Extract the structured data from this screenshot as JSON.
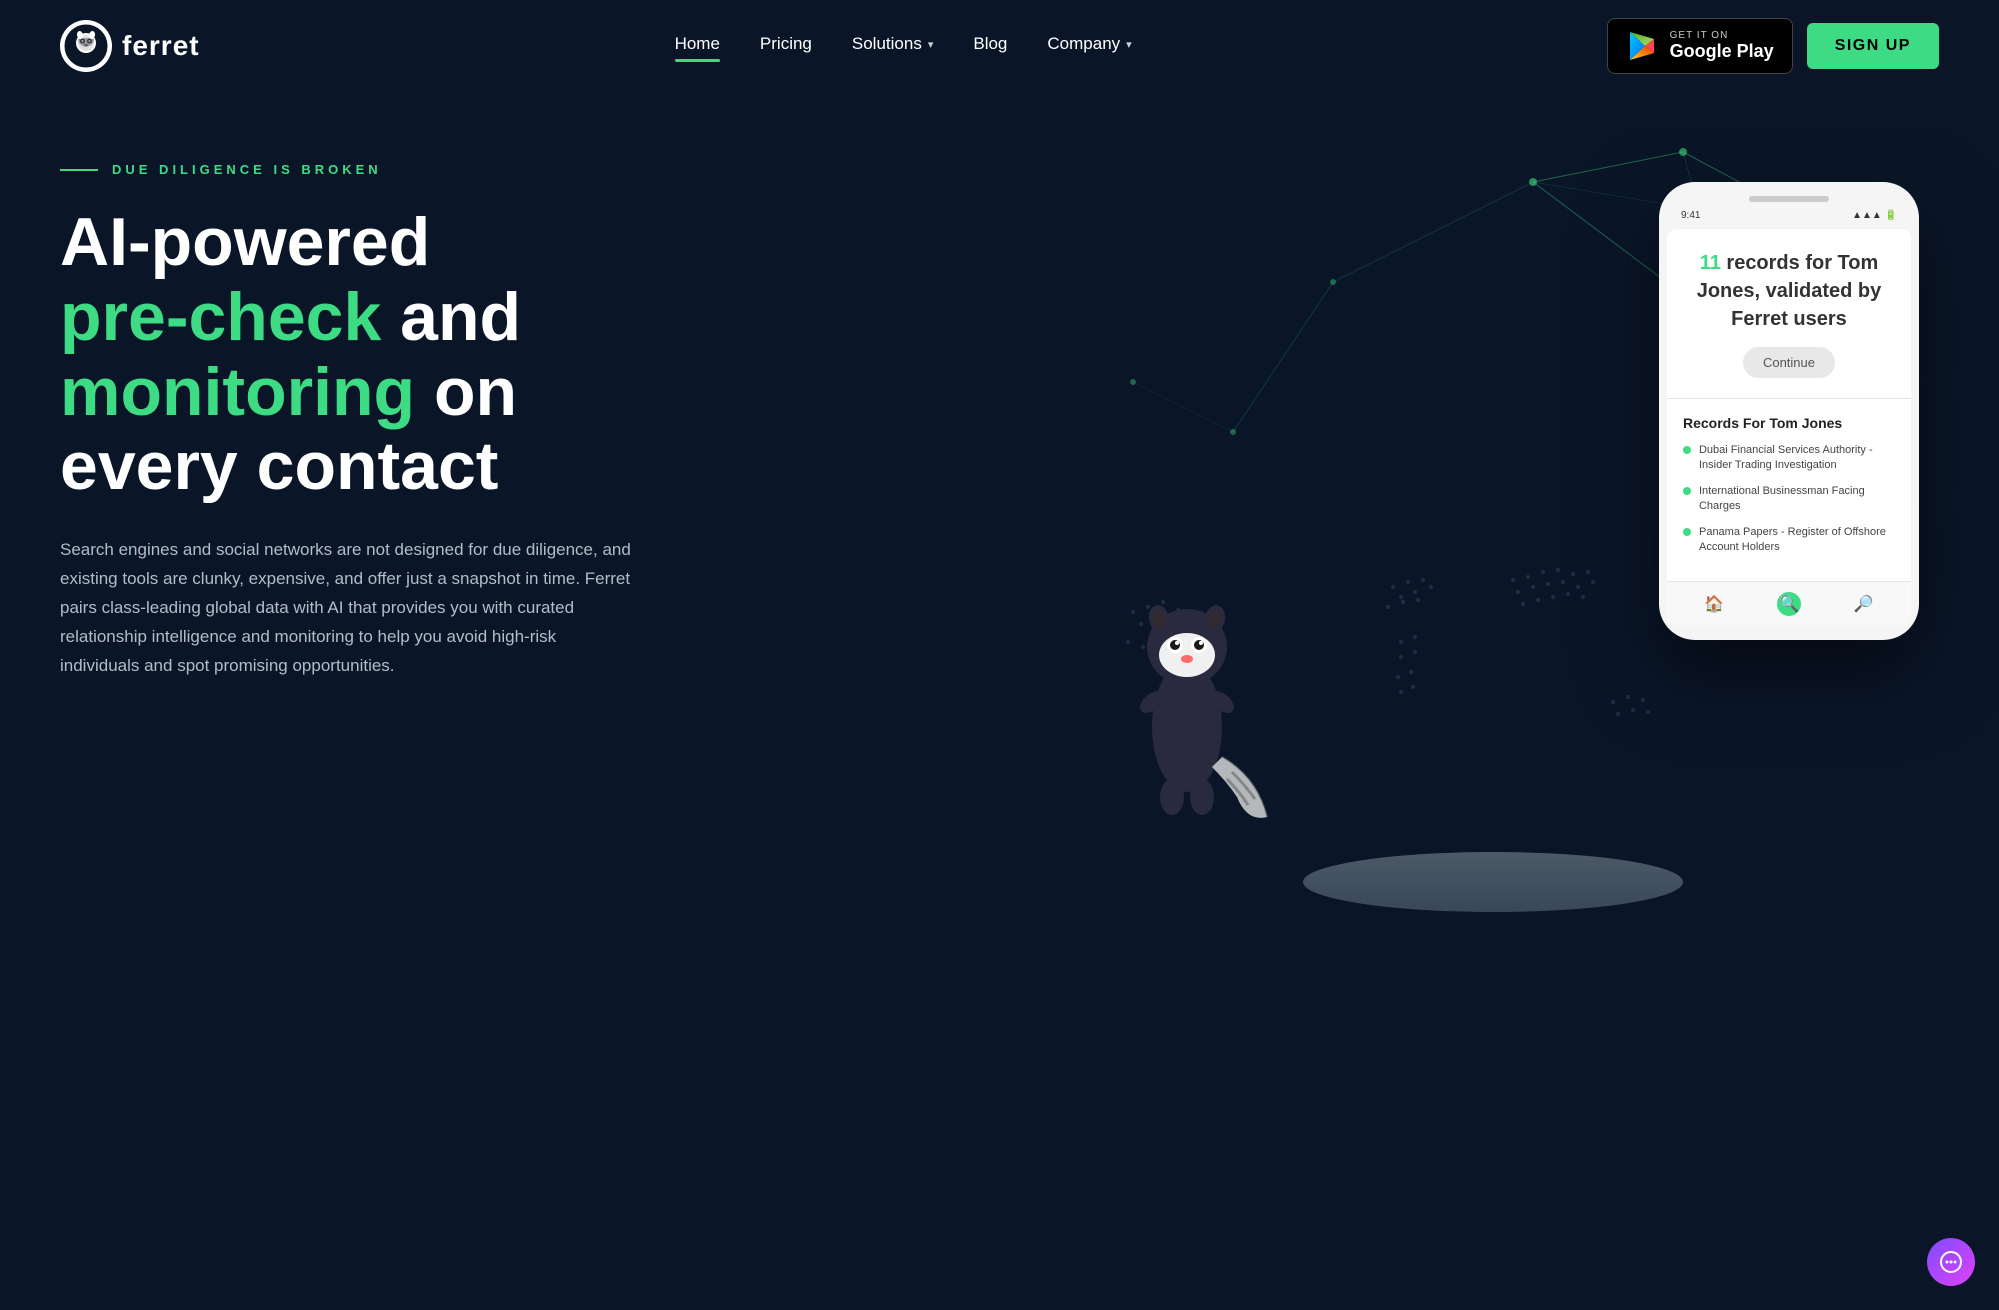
{
  "brand": {
    "name": "ferret"
  },
  "nav": {
    "items": [
      {
        "label": "Home",
        "active": true,
        "has_dropdown": false
      },
      {
        "label": "Pricing",
        "active": false,
        "has_dropdown": false
      },
      {
        "label": "Solutions",
        "active": false,
        "has_dropdown": true
      },
      {
        "label": "Blog",
        "active": false,
        "has_dropdown": false
      },
      {
        "label": "Company",
        "active": false,
        "has_dropdown": true
      }
    ]
  },
  "google_play": {
    "get_it_on": "GET IT ON",
    "label": "Google Play"
  },
  "signup": {
    "label": "SIGN UP"
  },
  "hero": {
    "tagline": "DUE DILIGENCE IS BROKEN",
    "title_line1": "AI-powered",
    "title_line2_green": "pre-check",
    "title_line2_white": " and",
    "title_line3_green": "monitoring",
    "title_line3_white": " on",
    "title_line4": "every contact",
    "description": "Search engines and social networks are not designed for due diligence, and existing tools are clunky, expensive, and offer just a snapshot in time. Ferret pairs class-leading global data with AI that provides you with curated relationship intelligence and monitoring to help you avoid high-risk individuals and spot promising opportunities."
  },
  "phone": {
    "time": "9:41",
    "record_count": "11",
    "record_text": "records for Tom Jones, validated by Ferret users",
    "continue_label": "Continue",
    "records_title": "Records For Tom Jones",
    "records": [
      "Dubai Financial Services Authority - Insider Trading Investigation",
      "International Businessman Facing Charges",
      "Panama Papers - Register of Offshore Account Holders"
    ]
  }
}
